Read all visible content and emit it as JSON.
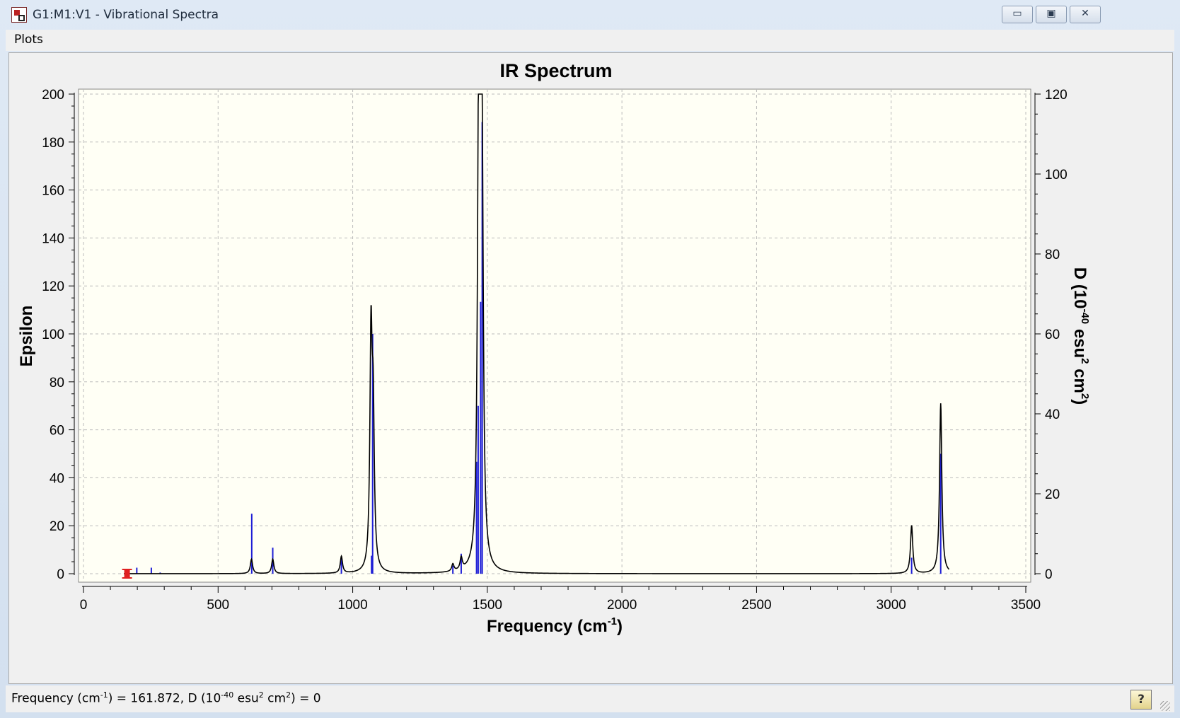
{
  "window": {
    "title": "G1:M1:V1 - Vibrational Spectra",
    "controls": {
      "minimize": "▭",
      "maximize": "▣",
      "close": "✕"
    }
  },
  "menu": {
    "plots": "Plots"
  },
  "status": {
    "freq_label": "Frequency (cm",
    "freq_sup": "-1",
    "freq_value": ") = 161.872, D (10",
    "d_sup": "-40",
    "d_unit": " esu",
    "d_sup2": "2",
    "d_tail": " cm",
    "d_sup3": "2",
    "d_value": ") = 0",
    "help_icon": "help-icon"
  },
  "colors": {
    "spectrum": "#000000",
    "sticks": "#1f1fd6",
    "cursor": "#e02020",
    "plot_bg": "#fffff5"
  },
  "chart_data": {
    "type": "line",
    "title": "IR Spectrum",
    "xlabel": "Frequency (cm-1)",
    "ylabel": "Epsilon",
    "y2label": "D (10-40 esu2 cm2)",
    "xlim": [
      0,
      3500
    ],
    "ylim": [
      0,
      200
    ],
    "y2lim": [
      0,
      120
    ],
    "x_ticks": [
      "0",
      "500",
      "1000",
      "1500",
      "2000",
      "2500",
      "3000",
      "3500"
    ],
    "y_ticks": [
      "0",
      "20",
      "40",
      "60",
      "80",
      "100",
      "120",
      "140",
      "160",
      "180",
      "200"
    ],
    "y2_ticks": [
      "0",
      "20",
      "40",
      "60",
      "80",
      "100",
      "120"
    ],
    "grid": true,
    "series": [
      {
        "kind": "spectrum",
        "peaks": [
          {
            "x": 624,
            "y": 6
          },
          {
            "x": 703,
            "y": 6
          },
          {
            "x": 958,
            "y": 7
          },
          {
            "x": 1068,
            "y": 95
          },
          {
            "x": 1076,
            "y": 60
          },
          {
            "x": 1372,
            "y": 3
          },
          {
            "x": 1403,
            "y": 5
          },
          {
            "x": 1467,
            "y": 120
          },
          {
            "x": 1473,
            "y": 199
          },
          {
            "x": 1481,
            "y": 132
          },
          {
            "x": 3076,
            "y": 20
          },
          {
            "x": 3184,
            "y": 71
          }
        ]
      },
      {
        "kind": "sticks",
        "points": [
          {
            "x": 198,
            "y": 1.5
          },
          {
            "x": 252,
            "y": 1.5
          },
          {
            "x": 285,
            "y": 0.3
          },
          {
            "x": 625,
            "y": 15
          },
          {
            "x": 703,
            "y": 6.5
          },
          {
            "x": 958,
            "y": 4.2
          },
          {
            "x": 1070,
            "y": 4.5
          },
          {
            "x": 1074,
            "y": 60
          },
          {
            "x": 1372,
            "y": 2
          },
          {
            "x": 1403,
            "y": 5
          },
          {
            "x": 1460,
            "y": 28
          },
          {
            "x": 1466,
            "y": 42
          },
          {
            "x": 1475,
            "y": 68
          },
          {
            "x": 1481,
            "y": 113
          },
          {
            "x": 3076,
            "y": 4
          },
          {
            "x": 3184,
            "y": 30
          }
        ]
      }
    ],
    "cursor": {
      "x": 161.872,
      "y": 0
    }
  }
}
